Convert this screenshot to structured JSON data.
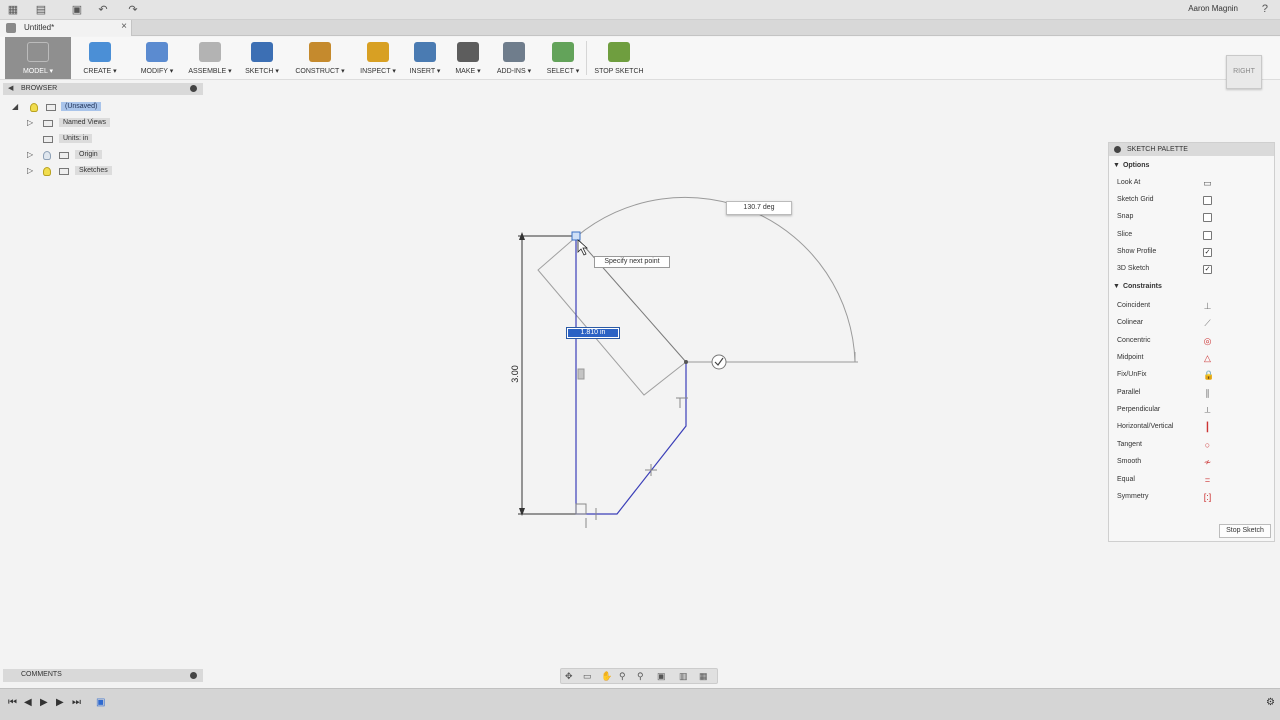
{
  "user": {
    "name": "Aaron Magnin"
  },
  "tab": {
    "title": "Untitled*"
  },
  "toolbar": [
    {
      "id": "model",
      "label": "MODEL",
      "color": "#d7d7d7"
    },
    {
      "id": "create",
      "label": "CREATE",
      "color": "#4b8fd6"
    },
    {
      "id": "modify",
      "label": "MODIFY",
      "color": "#5b8bd0"
    },
    {
      "id": "assemble",
      "label": "ASSEMBLE",
      "color": "#b3b3b3"
    },
    {
      "id": "sketch",
      "label": "SKETCH",
      "color": "#3c6fb4"
    },
    {
      "id": "construct",
      "label": "CONSTRUCT",
      "color": "#c58a2d"
    },
    {
      "id": "inspect",
      "label": "INSPECT",
      "color": "#d8a023"
    },
    {
      "id": "insert",
      "label": "INSERT",
      "color": "#4a7bb2"
    },
    {
      "id": "make",
      "label": "MAKE",
      "color": "#5d5d5d"
    },
    {
      "id": "add-ins",
      "label": "ADD-INS",
      "color": "#6f7d8c"
    },
    {
      "id": "select",
      "label": "SELECT",
      "color": "#63a35a"
    },
    {
      "id": "stop-sketch",
      "label": "STOP SKETCH",
      "color": "#6f9e3f"
    }
  ],
  "browser": {
    "title": "BROWSER",
    "items": [
      {
        "label": "(Unsaved)",
        "selected": true
      },
      {
        "label": "Named Views"
      },
      {
        "label": "Units: in"
      },
      {
        "label": "Origin"
      },
      {
        "label": "Sketches"
      }
    ]
  },
  "comments": {
    "title": "COMMENTS"
  },
  "viewcube": {
    "label": "RIGHT"
  },
  "canvas": {
    "angle": "130.7 deg",
    "tooltip": "Specify next point",
    "length": "1.810 in",
    "height_dim": "3.00"
  },
  "palette": {
    "title": "SKETCH PALETTE",
    "options_title": "Options",
    "options": [
      {
        "label": "Look At",
        "type": "icon"
      },
      {
        "label": "Sketch Grid",
        "checked": false
      },
      {
        "label": "Snap",
        "checked": false
      },
      {
        "label": "Slice",
        "checked": false
      },
      {
        "label": "Show Profile",
        "checked": true
      },
      {
        "label": "3D Sketch",
        "checked": true
      }
    ],
    "constraints_title": "Constraints",
    "constraints": [
      {
        "label": "Coincident",
        "icon": "coincident-icon",
        "glyph": "⊥",
        "color": "#777777"
      },
      {
        "label": "Colinear",
        "icon": "colinear-icon",
        "glyph": "⟋",
        "color": "#777777"
      },
      {
        "label": "Concentric",
        "icon": "concentric-icon",
        "glyph": "◎",
        "color": "#cc3333"
      },
      {
        "label": "Midpoint",
        "icon": "midpoint-icon",
        "glyph": "△",
        "color": "#cc3333"
      },
      {
        "label": "Fix/UnFix",
        "icon": "lock-icon",
        "glyph": "🔒",
        "color": "#cc3333"
      },
      {
        "label": "Parallel",
        "icon": "parallel-icon",
        "glyph": "∥",
        "color": "#777777"
      },
      {
        "label": "Perpendicular",
        "icon": "perpendicular-icon",
        "glyph": "⟂",
        "color": "#777777"
      },
      {
        "label": "Horizontal/Vertical",
        "icon": "horizontal-vertical-icon",
        "glyph": "┃",
        "color": "#cc3333"
      },
      {
        "label": "Tangent",
        "icon": "tangent-icon",
        "glyph": "○",
        "color": "#cc3333"
      },
      {
        "label": "Smooth",
        "icon": "smooth-icon",
        "glyph": "≁",
        "color": "#cc3333"
      },
      {
        "label": "Equal",
        "icon": "equal-icon",
        "glyph": "=",
        "color": "#cc3333"
      },
      {
        "label": "Symmetry",
        "icon": "symmetry-icon",
        "glyph": "[:]",
        "color": "#cc3333"
      }
    ],
    "stop_button": "Stop Sketch"
  }
}
